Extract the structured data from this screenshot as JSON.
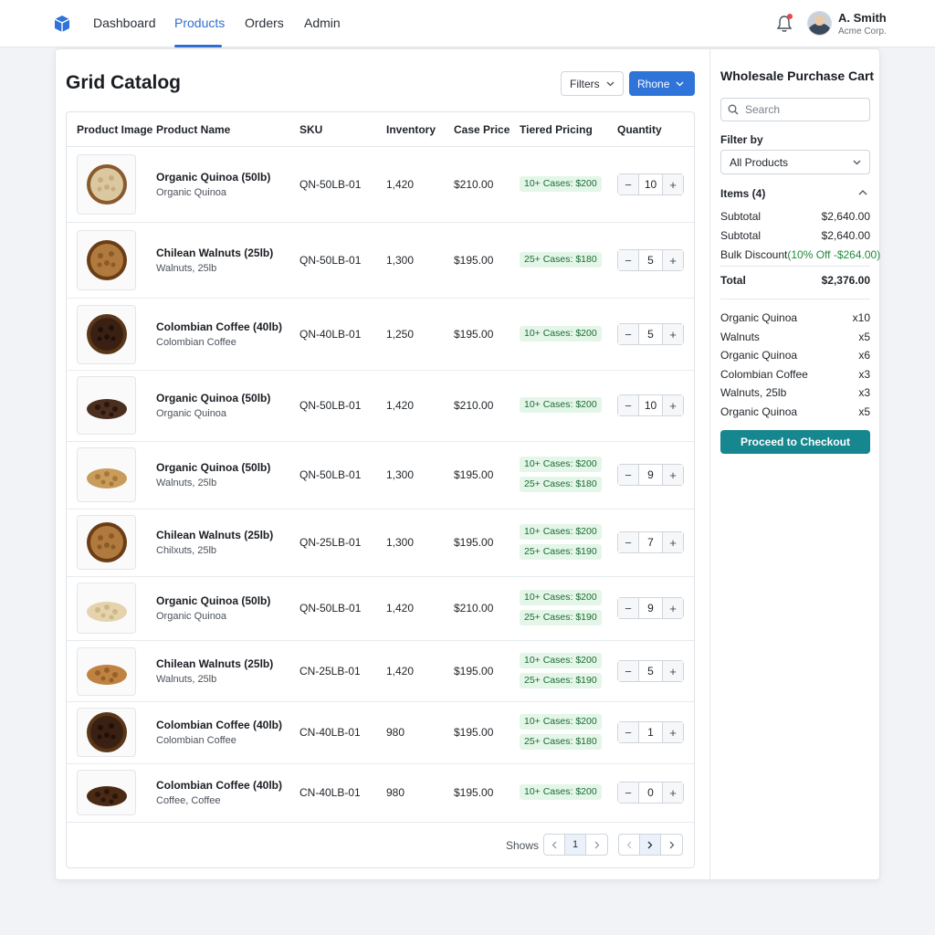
{
  "nav": {
    "items": [
      "Dashboard",
      "Products",
      "Orders",
      "Admin"
    ],
    "active": "Products",
    "user_name": "A. Smith",
    "user_org": "Acme Corp."
  },
  "catalog": {
    "title": "Grid Catalog",
    "filters_label": "Filters",
    "view_label": "Rhone",
    "columns": [
      "Product Image",
      "Product Name",
      "SKU",
      "Inventory",
      "Case Price",
      "Tiered Pricing",
      "Quantity"
    ],
    "rows": [
      {
        "name": "Organic Quinoa (50lb)",
        "sub": "Organic Quinoa",
        "sku": "QN-50LB-01",
        "inventory": "1,420",
        "price": "$210.00",
        "tiers": [
          "10+ Cases: $200"
        ],
        "qty": "10",
        "thumb": "quinoa-bowl"
      },
      {
        "name": "Chilean Walnuts (25lb)",
        "sub": "Walnuts, 25lb",
        "sku": "QN-50LB-01",
        "inventory": "1,300",
        "price": "$195.00",
        "tiers": [
          "25+ Cases: $180"
        ],
        "qty": "5",
        "thumb": "walnuts-bowl"
      },
      {
        "name": "Colombian Coffee (40lb)",
        "sub": "Colombian Coffee",
        "sku": "QN-40LB-01",
        "inventory": "1,250",
        "price": "$195.00",
        "tiers": [
          "10+ Cases: $200"
        ],
        "qty": "5",
        "thumb": "coffee-bowl"
      },
      {
        "name": "Organic Quinoa (50lb)",
        "sub": "Organic Quinoa",
        "sku": "QN-50LB-01",
        "inventory": "1,420",
        "price": "$210.00",
        "tiers": [
          "10+ Cases: $200"
        ],
        "qty": "10",
        "thumb": "dark-grain-pile"
      },
      {
        "name": "Organic Quinoa (50lb)",
        "sub": "Walnuts, 25lb",
        "sku": "QN-50LB-01",
        "inventory": "1,300",
        "price": "$195.00",
        "tiers": [
          "10+ Cases: $200",
          "25+ Cases: $180"
        ],
        "qty": "9",
        "thumb": "grain-pile"
      },
      {
        "name": "Chilean Walnuts (25lb)",
        "sub": "Chilxuts, 25lb",
        "sku": "QN-25LB-01",
        "inventory": "1,300",
        "price": "$195.00",
        "tiers": [
          "10+ Cases: $200",
          "25+ Cases: $190"
        ],
        "qty": "7",
        "thumb": "walnuts-bowl"
      },
      {
        "name": "Organic Quinoa (50lb)",
        "sub": "Organic Quinoa",
        "sku": "QN-50LB-01",
        "inventory": "1,420",
        "price": "$210.00",
        "tiers": [
          "10+ Cases: $200",
          "25+ Cases: $190"
        ],
        "qty": "9",
        "thumb": "quinoa-pile"
      },
      {
        "name": "Chilean Walnuts (25lb)",
        "sub": "Walnuts, 25lb",
        "sku": "CN-25LB-01",
        "inventory": "1,420",
        "price": "$195.00",
        "tiers": [
          "10+ Cases: $200",
          "25+ Cases: $190"
        ],
        "qty": "5",
        "thumb": "walnuts-pile"
      },
      {
        "name": "Colombian Coffee (40lb)",
        "sub": "Colombian Coffee",
        "sku": "CN-40LB-01",
        "inventory": "980",
        "price": "$195.00",
        "tiers": [
          "10+ Cases: $200",
          "25+ Cases: $180"
        ],
        "qty": "1",
        "thumb": "coffee-bowl"
      },
      {
        "name": "Colombian Coffee (40lb)",
        "sub": "Coffee, Coffee",
        "sku": "CN-40LB-01",
        "inventory": "980",
        "price": "$195.00",
        "tiers": [
          "10+ Cases: $200"
        ],
        "qty": "0",
        "thumb": "coffee-beans"
      }
    ],
    "shows_label": "Shows",
    "page": "1"
  },
  "cart": {
    "title": "Wholesale Purchase Cart",
    "search_placeholder": "Search",
    "filter_label": "Filter by",
    "filter_value": "All Products",
    "items_heading": "Items (4)",
    "subtotal_label": "Subtotal",
    "subtotal_value": "$2,640.00",
    "subtotal2_label": "Subtotal",
    "subtotal2_value": "$2,640.00",
    "discount_label": "Bulk Discount",
    "discount_value": "(10% Off -$264.00)",
    "total_label": "Total",
    "total_value": "$2,376.00",
    "lines": [
      {
        "name": "Organic Quinoa",
        "qty": "x10"
      },
      {
        "name": "Walnuts",
        "qty": "x5"
      },
      {
        "name": "Organic Quinoa",
        "qty": "x6"
      },
      {
        "name": "Colombian Coffee",
        "qty": "x3"
      },
      {
        "name": "Walnuts, 25lb",
        "qty": "x3"
      },
      {
        "name": "Organic Quinoa",
        "qty": "x5"
      }
    ],
    "checkout_label": "Proceed to Checkout"
  },
  "colors": {
    "accent": "#2f74d8",
    "checkout": "#16868f",
    "tier_bg": "#e3f6e8",
    "discount": "#1e8a3c"
  }
}
